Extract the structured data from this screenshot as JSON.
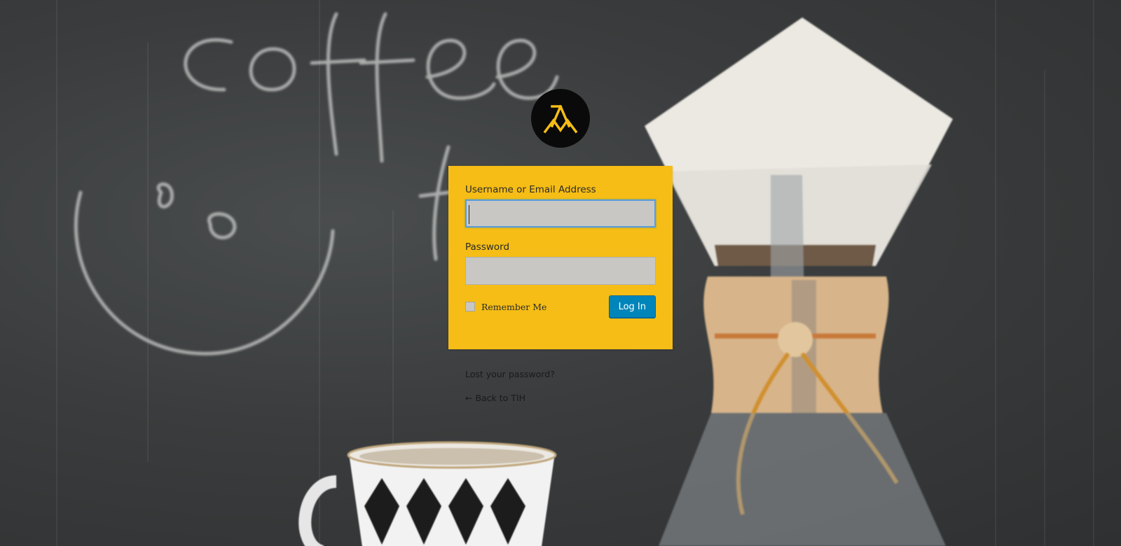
{
  "logo": {
    "icon": "am-monogram-icon",
    "letters": "ΛM",
    "background": "#0a0a0a",
    "color": "#f5bd15"
  },
  "background": {
    "description_icon": "coffee-chalkboard-photo",
    "chalk_text": "coffee t"
  },
  "form": {
    "background": "#f5bd15",
    "username_label": "Username or Email Address",
    "username_value": "",
    "password_label": "Password",
    "password_value": "",
    "remember_label": "Remember Me",
    "remember_checked": false,
    "submit_label": "Log In",
    "submit_color": "#0085ba"
  },
  "links": {
    "lost_password": "Lost your password?",
    "back_to_site": "← Back to TIH"
  }
}
